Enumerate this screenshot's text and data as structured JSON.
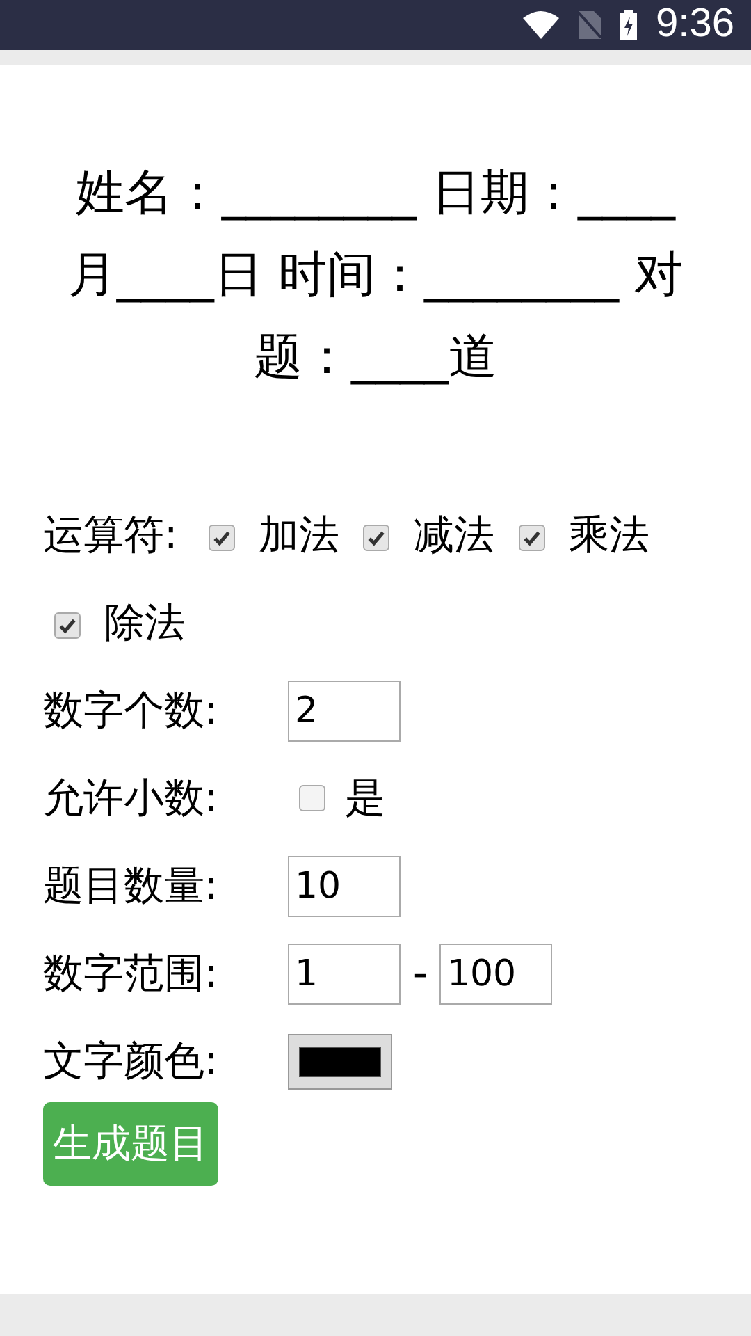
{
  "status_bar": {
    "time": "9:36"
  },
  "heading": "姓名：________ 日期：____月____日 时间：________ 对题：____道",
  "operators": {
    "label": "运算符:",
    "options": [
      {
        "label": "加法",
        "checked": true
      },
      {
        "label": "减法",
        "checked": true
      },
      {
        "label": "乘法",
        "checked": true
      },
      {
        "label": "除法",
        "checked": true
      }
    ]
  },
  "settings": [
    {
      "kind": "text",
      "label": "数字个数:",
      "value": "2"
    },
    {
      "kind": "checkbox",
      "label": "允许小数:",
      "option": "是",
      "checked": false
    },
    {
      "kind": "text",
      "label": "题目数量:",
      "value": "10"
    },
    {
      "kind": "range",
      "label": "数字范围:",
      "from": "1",
      "separator": "-",
      "to": "100"
    },
    {
      "kind": "color",
      "label": "文字颜色:",
      "color": "#000000"
    }
  ],
  "button": "生成题目"
}
